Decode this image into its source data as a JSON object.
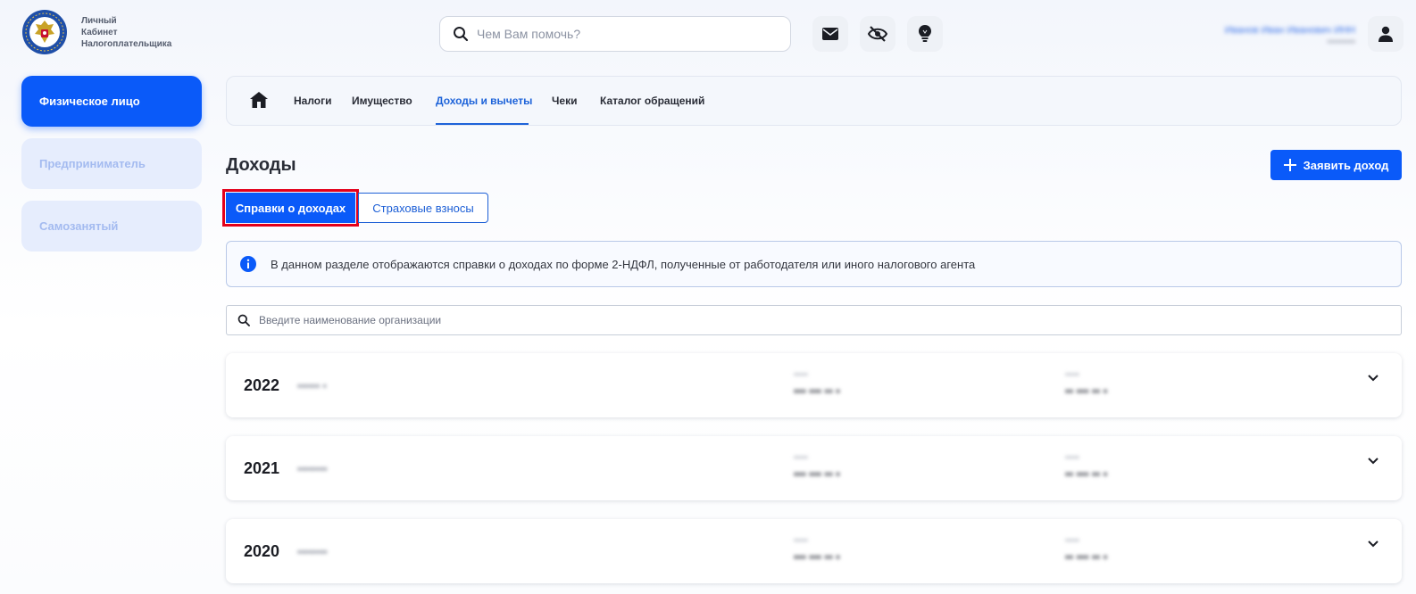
{
  "logo": {
    "lines": [
      "Личный",
      "Кабинет",
      "Налогоплательщика"
    ],
    "emblem_text": "ФЕДЕРАЛЬНАЯ НАЛОГОВАЯ СЛУЖБА"
  },
  "header": {
    "search_placeholder": "Чем Вам помочь?",
    "icons": [
      "mail-icon",
      "eye-off-icon",
      "lightbulb-icon",
      "user-icon"
    ],
    "user_name_blurred": "Иванов Иван Иванович ИНН",
    "user_meta_blurred": "•••••••••"
  },
  "sidebar": {
    "items": [
      {
        "label": "Физическое лицо",
        "active": true
      },
      {
        "label": "Предприниматель",
        "active": false
      },
      {
        "label": "Самозанятый",
        "active": false
      }
    ]
  },
  "topnav": {
    "home_icon": "home-icon",
    "tabs": [
      {
        "label": "Налоги",
        "active": false
      },
      {
        "label": "Имущество",
        "active": false
      },
      {
        "label": "Доходы и вычеты",
        "active": true
      },
      {
        "label": "Чеки",
        "active": false
      },
      {
        "label": "Каталог обращений",
        "active": false
      }
    ]
  },
  "page": {
    "title": "Доходы",
    "declare_button": "Заявить доход",
    "segments": [
      {
        "label": "Справки о доходах",
        "active": true
      },
      {
        "label": "Страховые взносы",
        "active": false
      }
    ],
    "info_text": "В данном разделе отображаются справки о доходах по форме 2-НДФЛ, полученные от работодателя или иного налогового агента",
    "org_search_placeholder": "Введите наименование организации"
  },
  "years": [
    {
      "year": "2022",
      "org": "•••••• •",
      "cap1": "•••••",
      "val1": "••• ••• •• •",
      "cap2": "•••••",
      "val2": "•• ••• •• •"
    },
    {
      "year": "2021",
      "org": "••••••••",
      "cap1": "•••••",
      "val1": "••• ••• •• •",
      "cap2": "•••••",
      "val2": "•• ••• •• •"
    },
    {
      "year": "2020",
      "org": "••••••••",
      "cap1": "•••••",
      "val1": "••• ••• •• •",
      "cap2": "•••••",
      "val2": "•• ••• •• •"
    }
  ],
  "colors": {
    "accent": "#0a5af9",
    "link": "#1d63d9",
    "highlight": "#e3001b"
  }
}
